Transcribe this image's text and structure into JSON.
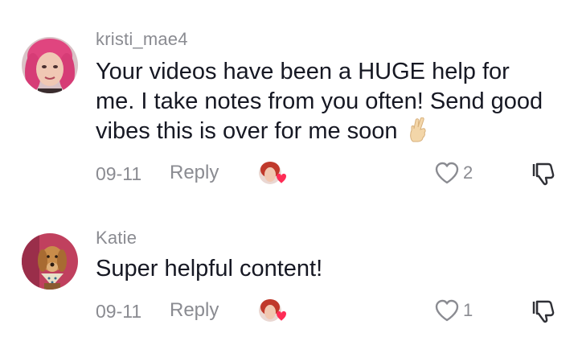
{
  "comments": [
    {
      "username": "kristi_mae4",
      "text": "Your videos have been a HUGE help for me. I take notes from you often! Send good vibes this is over for me soon",
      "emoji": "crossed-fingers-emoji",
      "date": "09-11",
      "reply_label": "Reply",
      "like_count": "2",
      "liked_by_creator": true
    },
    {
      "username": "Katie",
      "text": "Super helpful content!",
      "date": "09-11",
      "reply_label": "Reply",
      "like_count": "1",
      "liked_by_creator": true
    }
  ],
  "colors": {
    "text": "#161823",
    "muted": "#8a8b91",
    "heart": "#fe2c55"
  }
}
